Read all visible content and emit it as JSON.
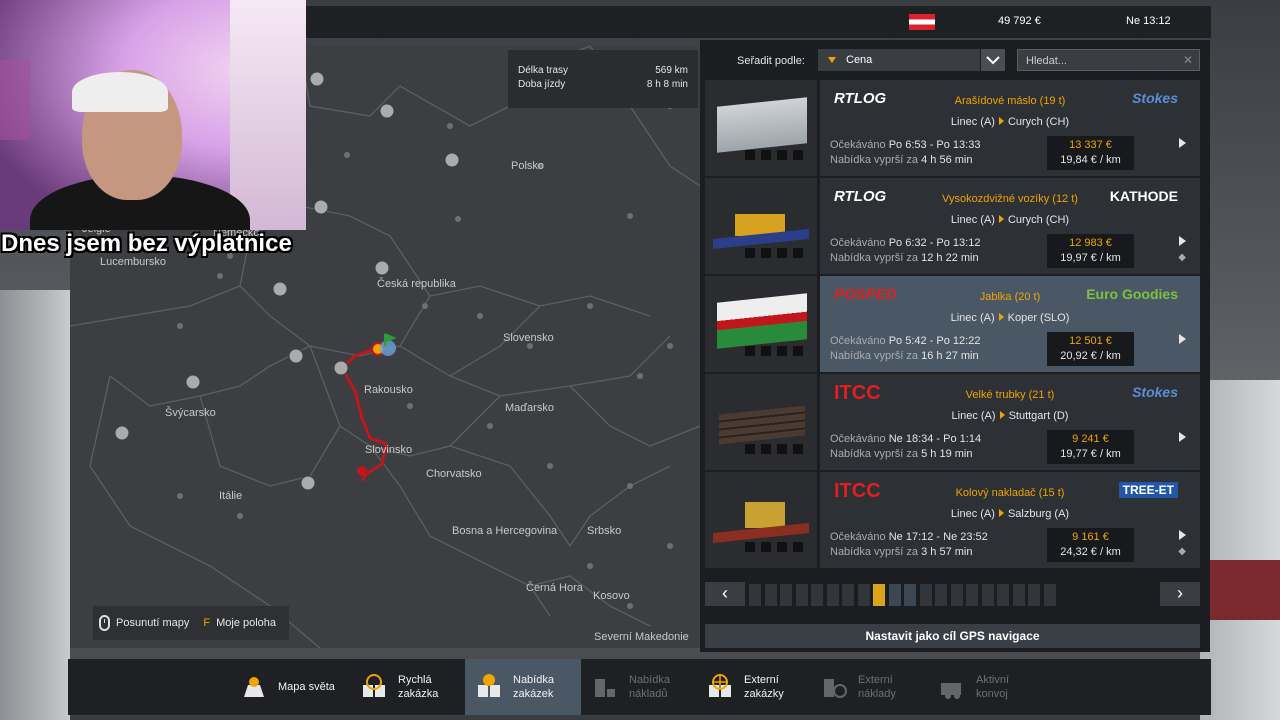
{
  "topbar": {
    "money": "49 792 €",
    "clock": "Ne 13:12"
  },
  "overlay": {
    "caption": "Dnes jsem bez výplatnice"
  },
  "map": {
    "route_info": {
      "length_label": "Délka trasy",
      "length_value": "569 km",
      "time_label": "Doba jízdy",
      "time_value": "8 h 8 min"
    },
    "labels": [
      "Polsko",
      "Česká republika",
      "Slovensko",
      "Rakousko",
      "Maďarsko",
      "Švýcarsko",
      "Slovinsko",
      "Chorvatsko",
      "Itálie",
      "Bosna a Hercegovina",
      "Srbsko",
      "Černá Hora",
      "Kosovo",
      "Severní Makedonie",
      "Lucembursko",
      "Jeigie",
      "Německo"
    ],
    "buttons": {
      "pan": "Posunutí mapy",
      "key": "F",
      "my_position": "Moje poloha"
    }
  },
  "sort": {
    "label": "Seřadit podle:",
    "value": "Cena",
    "search_placeholder": "Hledat..."
  },
  "offers": [
    {
      "company": "RTLOG",
      "cargo": "Arašídové máslo (19 t)",
      "client": "Stokes",
      "from": "Linec (A)",
      "to": "Curych (CH)",
      "expected_label": "Očekáváno",
      "expected": "Po 6:53 - Po 13:33",
      "expires_label": "Nabídka vyprší za",
      "expires": "4 h 56 min",
      "price": "13 337 €",
      "per_km": "19,84 € / km"
    },
    {
      "company": "RTLOG",
      "cargo": "Vysokozdvižné vozíky (12 t)",
      "client": "KATHODE",
      "from": "Linec (A)",
      "to": "Curych (CH)",
      "expected_label": "Očekáváno",
      "expected": "Po 6:32 - Po 13:12",
      "expires_label": "Nabídka vyprší za",
      "expires": "12 h 22 min",
      "price": "12 983 €",
      "per_km": "19,97 € / km"
    },
    {
      "company": "POSPED",
      "cargo": "Jablka (20 t)",
      "client": "Euro Goodies",
      "from": "Linec (A)",
      "to": "Koper (SLO)",
      "expected_label": "Očekáváno",
      "expected": "Po 5:42 - Po 12:22",
      "expires_label": "Nabídka vyprší za",
      "expires": "16 h 27 min",
      "price": "12 501 €",
      "per_km": "20,92 € / km"
    },
    {
      "company": "ITCC",
      "cargo": "Velké trubky (21 t)",
      "client": "Stokes",
      "from": "Linec (A)",
      "to": "Stuttgart (D)",
      "expected_label": "Očekáváno",
      "expected": "Ne 18:34 - Po 1:14",
      "expires_label": "Nabídka vyprší za",
      "expires": "5 h 19 min",
      "price": "9 241 €",
      "per_km": "19,77 € / km"
    },
    {
      "company": "ITCC",
      "cargo": "Kolový nakladač (15 t)",
      "client": "TREE-ET",
      "from": "Linec (A)",
      "to": "Salzburg (A)",
      "expected_label": "Očekáváno",
      "expected": "Ne 17:12 - Ne 23:52",
      "expires_label": "Nabídka vyprší za",
      "expires": "3 h 57 min",
      "price": "9 161 €",
      "per_km": "24,32 € / km"
    }
  ],
  "gps_button": "Nastavit jako cíl GPS navigace",
  "nav": [
    {
      "label": "Mapa světa",
      "icon": "world-map-icon",
      "state": "normal"
    },
    {
      "label": "Rychlá zakázka",
      "icon": "quick-job-icon",
      "state": "normal"
    },
    {
      "label": "Nabídka zakázek",
      "icon": "job-offers-icon",
      "state": "active"
    },
    {
      "label": "Nabídka nákladů",
      "icon": "cargo-market-icon",
      "state": "disabled"
    },
    {
      "label": "Externí zakázky",
      "icon": "external-jobs-icon",
      "state": "normal"
    },
    {
      "label": "Externí náklady",
      "icon": "external-cargo-icon",
      "state": "disabled"
    },
    {
      "label": "Aktivní konvoj",
      "icon": "active-convoy-icon",
      "state": "disabled"
    }
  ],
  "colors": {
    "accent": "#f0a400",
    "route": "#c0161c",
    "selected_row": "#4a5866"
  }
}
